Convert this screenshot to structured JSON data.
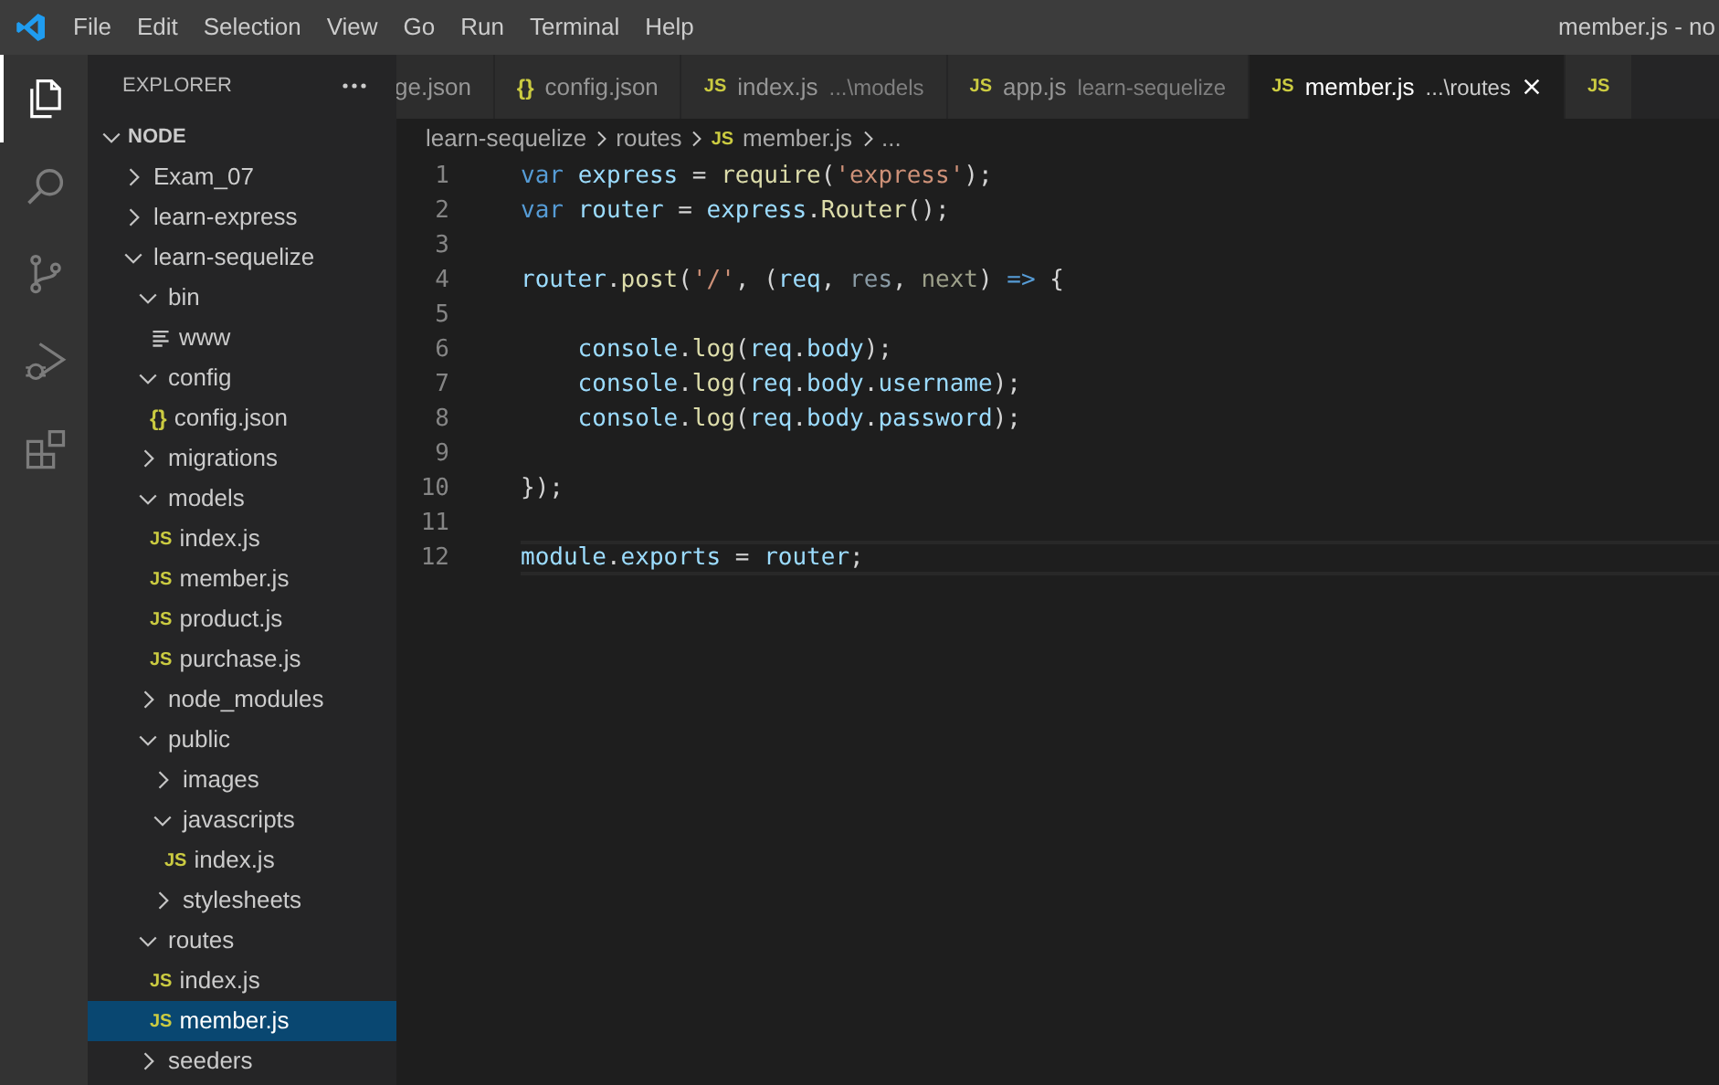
{
  "menu": [
    "File",
    "Edit",
    "Selection",
    "View",
    "Go",
    "Run",
    "Terminal",
    "Help"
  ],
  "window": {
    "title": "member.js - no"
  },
  "activity_bar": [
    {
      "kind": "files",
      "selected": true
    },
    {
      "kind": "search",
      "selected": false
    },
    {
      "kind": "source-control",
      "selected": false
    },
    {
      "kind": "debug",
      "selected": false
    },
    {
      "kind": "extensions",
      "selected": false
    }
  ],
  "explorer": {
    "title": "EXPLORER",
    "workspace": {
      "label": "NODE",
      "expanded": true,
      "children": [
        {
          "label": "Exam_07",
          "kind": "folder",
          "expanded": false,
          "selected": false
        },
        {
          "label": "learn-express",
          "kind": "folder",
          "expanded": false,
          "selected": false
        },
        {
          "label": "learn-sequelize",
          "kind": "folder",
          "expanded": true,
          "selected": false,
          "children": [
            {
              "label": "bin",
              "kind": "folder",
              "expanded": true,
              "selected": false,
              "children": [
                {
                  "label": "www",
                  "kind": "text",
                  "selected": false
                }
              ]
            },
            {
              "label": "config",
              "kind": "folder",
              "expanded": true,
              "selected": false,
              "children": [
                {
                  "label": "config.json",
                  "kind": "json",
                  "badge": "{}",
                  "selected": false
                }
              ]
            },
            {
              "label": "migrations",
              "kind": "folder",
              "expanded": false,
              "selected": false
            },
            {
              "label": "models",
              "kind": "folder",
              "expanded": true,
              "selected": false,
              "children": [
                {
                  "label": "index.js",
                  "kind": "js",
                  "badge": "JS",
                  "selected": false
                },
                {
                  "label": "member.js",
                  "kind": "js",
                  "badge": "JS",
                  "selected": false
                },
                {
                  "label": "product.js",
                  "kind": "js",
                  "badge": "JS",
                  "selected": false
                },
                {
                  "label": "purchase.js",
                  "kind": "js",
                  "badge": "JS",
                  "selected": false
                }
              ]
            },
            {
              "label": "node_modules",
              "kind": "folder",
              "expanded": false,
              "selected": false
            },
            {
              "label": "public",
              "kind": "folder",
              "expanded": true,
              "selected": false,
              "children": [
                {
                  "label": "images",
                  "kind": "folder",
                  "expanded": false,
                  "selected": false
                },
                {
                  "label": "javascripts",
                  "kind": "folder",
                  "expanded": true,
                  "selected": false,
                  "children": [
                    {
                      "label": "index.js",
                      "kind": "js",
                      "badge": "JS",
                      "selected": false
                    }
                  ]
                },
                {
                  "label": "stylesheets",
                  "kind": "folder",
                  "expanded": false,
                  "selected": false
                }
              ]
            },
            {
              "label": "routes",
              "kind": "folder",
              "expanded": true,
              "selected": false,
              "children": [
                {
                  "label": "index.js",
                  "kind": "js",
                  "badge": "JS",
                  "selected": false
                },
                {
                  "label": "member.js",
                  "kind": "js",
                  "badge": "JS",
                  "selected": true
                }
              ]
            },
            {
              "label": "seeders",
              "kind": "folder",
              "expanded": false,
              "selected": false
            }
          ]
        }
      ]
    }
  },
  "tabs": [
    {
      "label": "ge.json",
      "selected": false,
      "close_button": false
    },
    {
      "label": "config.json",
      "badge": "{}",
      "selected": false,
      "close_button": false
    },
    {
      "label": "index.js",
      "badge": "JS",
      "detail": "...\\models",
      "selected": false,
      "close_button": false
    },
    {
      "label": "app.js",
      "badge": "JS",
      "detail": "learn-sequelize",
      "selected": false,
      "close_button": false
    },
    {
      "label": "member.js",
      "badge": "JS",
      "detail": "...\\routes",
      "selected": true,
      "close_button": true
    },
    {
      "badge": "JS",
      "selected": false,
      "close_button": false
    }
  ],
  "breadcrumb": [
    {
      "label": "learn-sequelize"
    },
    {
      "label": "routes"
    },
    {
      "label": "member.js",
      "badge": "JS"
    },
    {
      "label": "..."
    }
  ],
  "code": [
    {
      "number": "1",
      "current": false,
      "tokens": [
        {
          "kind": "keyword",
          "text": "var "
        },
        {
          "kind": "variable",
          "text": "express"
        },
        {
          "kind": "punct",
          "text": " = "
        },
        {
          "kind": "function",
          "text": "require"
        },
        {
          "kind": "punct",
          "text": "("
        },
        {
          "kind": "string",
          "text": "'express'"
        },
        {
          "kind": "punct",
          "text": ");"
        }
      ]
    },
    {
      "number": "2",
      "current": false,
      "tokens": [
        {
          "kind": "keyword",
          "text": "var "
        },
        {
          "kind": "variable",
          "text": "router"
        },
        {
          "kind": "punct",
          "text": " = "
        },
        {
          "kind": "variable",
          "text": "express"
        },
        {
          "kind": "punct",
          "text": "."
        },
        {
          "kind": "function",
          "text": "Router"
        },
        {
          "kind": "punct",
          "text": "();"
        }
      ]
    },
    {
      "number": "3",
      "current": false
    },
    {
      "number": "4",
      "current": false,
      "tokens": [
        {
          "kind": "variable",
          "text": "router"
        },
        {
          "kind": "punct",
          "text": "."
        },
        {
          "kind": "function",
          "text": "post"
        },
        {
          "kind": "punct",
          "text": "("
        },
        {
          "kind": "string",
          "text": "'/'"
        },
        {
          "kind": "punct",
          "text": ", ("
        },
        {
          "kind": "variable",
          "text": "req"
        },
        {
          "kind": "punct",
          "text": ", "
        },
        {
          "kind": "unused",
          "text": "res"
        },
        {
          "kind": "punct",
          "text": ", "
        },
        {
          "kind": "unused2",
          "text": "next"
        },
        {
          "kind": "punct",
          "text": ") "
        },
        {
          "kind": "keyword",
          "text": "=>"
        },
        {
          "kind": "punct",
          "text": " {"
        }
      ]
    },
    {
      "number": "5",
      "current": false
    },
    {
      "number": "6",
      "current": false,
      "tokens": [
        {
          "kind": "variable",
          "text": "    console"
        },
        {
          "kind": "punct",
          "text": "."
        },
        {
          "kind": "function",
          "text": "log"
        },
        {
          "kind": "punct",
          "text": "("
        },
        {
          "kind": "variable",
          "text": "req"
        },
        {
          "kind": "punct",
          "text": "."
        },
        {
          "kind": "variable",
          "text": "body"
        },
        {
          "kind": "punct",
          "text": ");"
        }
      ]
    },
    {
      "number": "7",
      "current": false,
      "tokens": [
        {
          "kind": "variable",
          "text": "    console"
        },
        {
          "kind": "punct",
          "text": "."
        },
        {
          "kind": "function",
          "text": "log"
        },
        {
          "kind": "punct",
          "text": "("
        },
        {
          "kind": "variable",
          "text": "req"
        },
        {
          "kind": "punct",
          "text": "."
        },
        {
          "kind": "variable",
          "text": "body"
        },
        {
          "kind": "punct",
          "text": "."
        },
        {
          "kind": "variable",
          "text": "username"
        },
        {
          "kind": "punct",
          "text": ");"
        }
      ]
    },
    {
      "number": "8",
      "current": false,
      "tokens": [
        {
          "kind": "variable",
          "text": "    console"
        },
        {
          "kind": "punct",
          "text": "."
        },
        {
          "kind": "function",
          "text": "log"
        },
        {
          "kind": "punct",
          "text": "("
        },
        {
          "kind": "variable",
          "text": "req"
        },
        {
          "kind": "punct",
          "text": "."
        },
        {
          "kind": "variable",
          "text": "body"
        },
        {
          "kind": "punct",
          "text": "."
        },
        {
          "kind": "variable",
          "text": "password"
        },
        {
          "kind": "punct",
          "text": ");"
        }
      ]
    },
    {
      "number": "9",
      "current": false
    },
    {
      "number": "10",
      "current": false,
      "tokens": [
        {
          "kind": "punct",
          "text": "});"
        }
      ]
    },
    {
      "number": "11",
      "current": false
    },
    {
      "number": "12",
      "current": true,
      "tokens": [
        {
          "kind": "variable",
          "text": "module"
        },
        {
          "kind": "punct",
          "text": "."
        },
        {
          "kind": "variable",
          "text": "exports"
        },
        {
          "kind": "punct",
          "text": " = "
        },
        {
          "kind": "variable",
          "text": "router"
        },
        {
          "kind": "punct",
          "text": ";"
        }
      ]
    }
  ]
}
